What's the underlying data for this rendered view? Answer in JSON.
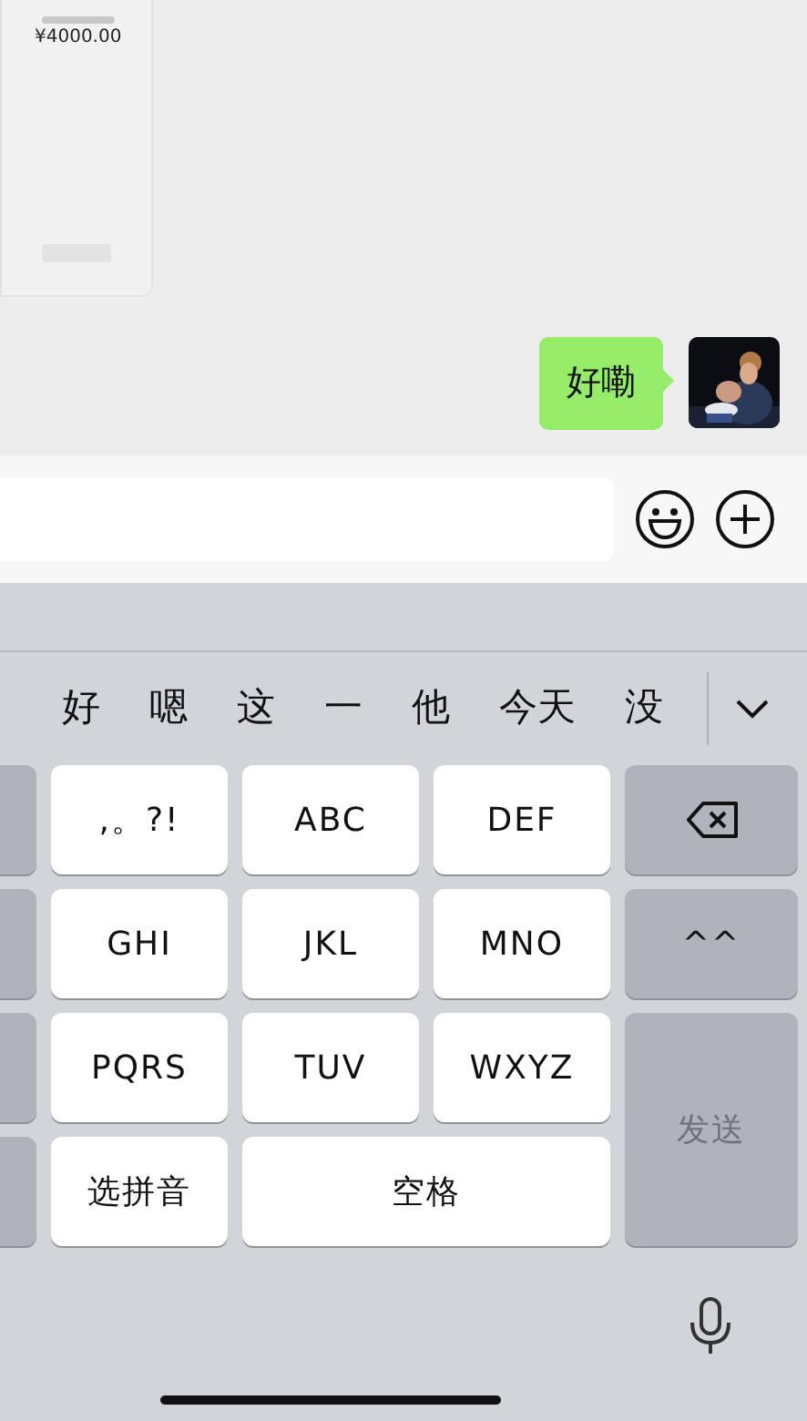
{
  "chat": {
    "transfer_card": {
      "amount": "¥4000.00"
    },
    "messages": [
      {
        "text": "好嘞",
        "outgoing": true
      }
    ]
  },
  "keyboard": {
    "candidates": [
      "好",
      "嗯",
      "这",
      "一",
      "他",
      "今天",
      "没"
    ],
    "keys": [
      {
        "label": ",。?!",
        "kind": "char"
      },
      {
        "label": "ABC",
        "kind": "char"
      },
      {
        "label": "DEF",
        "kind": "char"
      },
      {
        "kind": "backspace"
      },
      {
        "label": "GHI",
        "kind": "char"
      },
      {
        "label": "JKL",
        "kind": "char"
      },
      {
        "label": "MNO",
        "kind": "char"
      },
      {
        "label": "^^",
        "kind": "function"
      },
      {
        "label": "PQRS",
        "kind": "char"
      },
      {
        "label": "TUV",
        "kind": "char"
      },
      {
        "label": "WXYZ",
        "kind": "char"
      },
      {
        "label": "发送",
        "kind": "send",
        "disabled": true
      },
      {
        "label": "选拼音",
        "kind": "char"
      },
      {
        "label": "空格",
        "kind": "space"
      }
    ]
  }
}
